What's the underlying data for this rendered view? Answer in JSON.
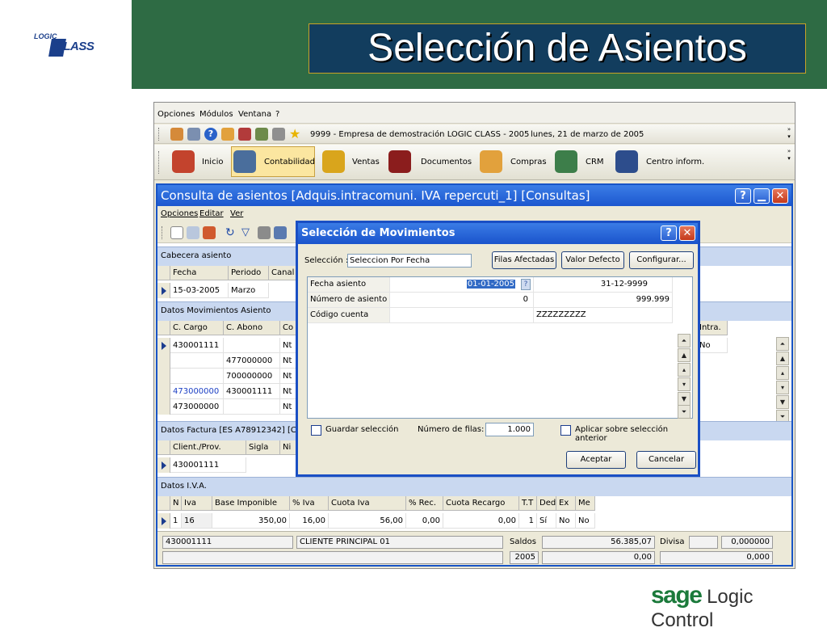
{
  "slide": {
    "title": "Selección de Asientos",
    "logo_top": "LOGIC",
    "logo_main": "CLASS",
    "brand_sage": "sage",
    "brand_rest": "Logic Control"
  },
  "menubar": [
    "Opciones",
    "Módulos",
    "Ventana",
    "?"
  ],
  "toolbar_info": {
    "company": "9999 - Empresa de demostración LOGIC CLASS - 2005",
    "date": "lunes, 21 de marzo de 2005"
  },
  "modules": [
    {
      "label": "Inicio",
      "icon": "home-icon"
    },
    {
      "label": "Contabilidad",
      "icon": "scales-icon"
    },
    {
      "label": "Ventas",
      "icon": "coins-icon"
    },
    {
      "label": "Documentos",
      "icon": "binders-icon"
    },
    {
      "label": "Compras",
      "icon": "box-icon"
    },
    {
      "label": "CRM",
      "icon": "people-icon"
    },
    {
      "label": "Centro inform.",
      "icon": "info-center-icon"
    }
  ],
  "inner_window": {
    "title": "Consulta de asientos [Adquis.intracomuni. IVA repercuti_1] [Consultas]",
    "menu": [
      "Opciones",
      "Editar",
      "Ver"
    ],
    "cabecera": {
      "section": "Cabecera asiento",
      "headers": [
        "Fecha",
        "Periodo",
        "Canal"
      ],
      "row": [
        "15-03-2005",
        "Marzo",
        ""
      ]
    },
    "movimientos": {
      "section": "Datos Movimientos Asiento",
      "headers": [
        "C. Cargo",
        "C. Abono",
        "Co"
      ],
      "right_header": "Intra.",
      "rows": [
        {
          "cargo": "430001111",
          "abono": "",
          "co": "Nt",
          "intra": "No"
        },
        {
          "cargo": "",
          "abono": "477000000",
          "co": "Nt",
          "intra": ""
        },
        {
          "cargo": "",
          "abono": "700000000",
          "co": "Nt",
          "intra": ""
        },
        {
          "cargo": "473000000",
          "abono": "430001111",
          "co": "Nt",
          "intra": ""
        },
        {
          "cargo": "473000000",
          "abono": "",
          "co": "Nt",
          "intra": ""
        }
      ]
    },
    "factura": {
      "section": "Datos Factura [ES A78912342] [CL",
      "headers": [
        "Client./Prov.",
        "Sigla",
        "Ni"
      ],
      "row": [
        "430001111",
        "",
        ""
      ]
    },
    "iva": {
      "section": "Datos I.V.A.",
      "headers": [
        "N",
        "Iva",
        "Base Imponible",
        "% Iva",
        "Cuota Iva",
        "% Rec.",
        "Cuota Recargo",
        "T.T",
        "Ded",
        "Ex",
        "Me"
      ],
      "row": [
        "1",
        "16",
        "350,00",
        "16,00",
        "56,00",
        "0,00",
        "0,00",
        "1",
        "Sí",
        "No",
        "No"
      ]
    },
    "footer": {
      "account": "430001111",
      "client": "CLIENTE PRINCIPAL 01",
      "saldos_label": "Saldos",
      "saldo_value": "56.385,07",
      "divisa_label": "Divisa",
      "divisa_value": "0,000000",
      "year": "2005",
      "value2": "0,00",
      "value3": "0,000"
    }
  },
  "dialog": {
    "title": "Selección de Movimientos",
    "seleccion_label": "Selección :",
    "seleccion_value": "Seleccion Por Fecha",
    "btn_filas": "Filas Afectadas",
    "btn_valor": "Valor Defecto",
    "btn_config": "Configurar...",
    "rows": [
      {
        "label": "Fecha asiento",
        "from": "01-01-2005",
        "to": "31-12-9999"
      },
      {
        "label": "Número de asiento",
        "from": "0",
        "to": "999.999"
      },
      {
        "label": "Código cuenta",
        "from": "",
        "to": "ZZZZZZZZZ"
      }
    ],
    "guardar_label": "Guardar selección",
    "num_filas_label": "Número de filas:",
    "num_filas_value": "1.000",
    "aplicar_label": "Aplicar sobre selección anterior",
    "btn_aceptar": "Aceptar",
    "btn_cancelar": "Cancelar"
  },
  "colors": {
    "band_green": "#2e6b44",
    "title_box": "#123d5e",
    "xp_blue": "#1c57cf",
    "link_blue": "#1b3fc4"
  }
}
